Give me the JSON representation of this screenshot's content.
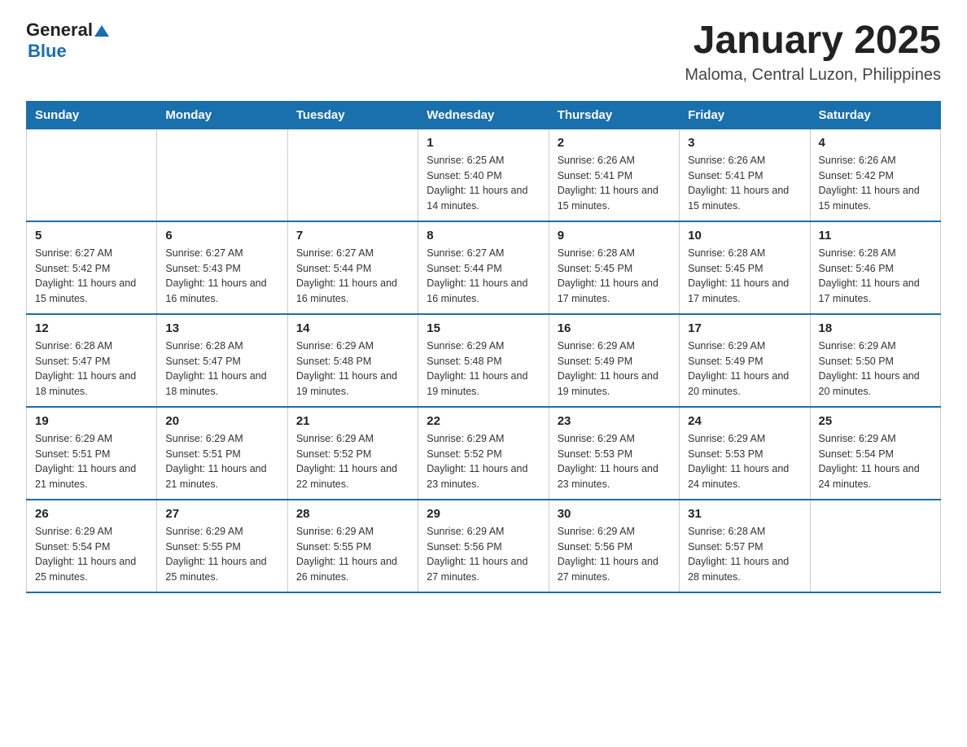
{
  "logo": {
    "general": "General",
    "blue": "Blue"
  },
  "title": "January 2025",
  "subtitle": "Maloma, Central Luzon, Philippines",
  "days_of_week": [
    "Sunday",
    "Monday",
    "Tuesday",
    "Wednesday",
    "Thursday",
    "Friday",
    "Saturday"
  ],
  "weeks": [
    [
      {
        "day": "",
        "info": ""
      },
      {
        "day": "",
        "info": ""
      },
      {
        "day": "",
        "info": ""
      },
      {
        "day": "1",
        "info": "Sunrise: 6:25 AM\nSunset: 5:40 PM\nDaylight: 11 hours and 14 minutes."
      },
      {
        "day": "2",
        "info": "Sunrise: 6:26 AM\nSunset: 5:41 PM\nDaylight: 11 hours and 15 minutes."
      },
      {
        "day": "3",
        "info": "Sunrise: 6:26 AM\nSunset: 5:41 PM\nDaylight: 11 hours and 15 minutes."
      },
      {
        "day": "4",
        "info": "Sunrise: 6:26 AM\nSunset: 5:42 PM\nDaylight: 11 hours and 15 minutes."
      }
    ],
    [
      {
        "day": "5",
        "info": "Sunrise: 6:27 AM\nSunset: 5:42 PM\nDaylight: 11 hours and 15 minutes."
      },
      {
        "day": "6",
        "info": "Sunrise: 6:27 AM\nSunset: 5:43 PM\nDaylight: 11 hours and 16 minutes."
      },
      {
        "day": "7",
        "info": "Sunrise: 6:27 AM\nSunset: 5:44 PM\nDaylight: 11 hours and 16 minutes."
      },
      {
        "day": "8",
        "info": "Sunrise: 6:27 AM\nSunset: 5:44 PM\nDaylight: 11 hours and 16 minutes."
      },
      {
        "day": "9",
        "info": "Sunrise: 6:28 AM\nSunset: 5:45 PM\nDaylight: 11 hours and 17 minutes."
      },
      {
        "day": "10",
        "info": "Sunrise: 6:28 AM\nSunset: 5:45 PM\nDaylight: 11 hours and 17 minutes."
      },
      {
        "day": "11",
        "info": "Sunrise: 6:28 AM\nSunset: 5:46 PM\nDaylight: 11 hours and 17 minutes."
      }
    ],
    [
      {
        "day": "12",
        "info": "Sunrise: 6:28 AM\nSunset: 5:47 PM\nDaylight: 11 hours and 18 minutes."
      },
      {
        "day": "13",
        "info": "Sunrise: 6:28 AM\nSunset: 5:47 PM\nDaylight: 11 hours and 18 minutes."
      },
      {
        "day": "14",
        "info": "Sunrise: 6:29 AM\nSunset: 5:48 PM\nDaylight: 11 hours and 19 minutes."
      },
      {
        "day": "15",
        "info": "Sunrise: 6:29 AM\nSunset: 5:48 PM\nDaylight: 11 hours and 19 minutes."
      },
      {
        "day": "16",
        "info": "Sunrise: 6:29 AM\nSunset: 5:49 PM\nDaylight: 11 hours and 19 minutes."
      },
      {
        "day": "17",
        "info": "Sunrise: 6:29 AM\nSunset: 5:49 PM\nDaylight: 11 hours and 20 minutes."
      },
      {
        "day": "18",
        "info": "Sunrise: 6:29 AM\nSunset: 5:50 PM\nDaylight: 11 hours and 20 minutes."
      }
    ],
    [
      {
        "day": "19",
        "info": "Sunrise: 6:29 AM\nSunset: 5:51 PM\nDaylight: 11 hours and 21 minutes."
      },
      {
        "day": "20",
        "info": "Sunrise: 6:29 AM\nSunset: 5:51 PM\nDaylight: 11 hours and 21 minutes."
      },
      {
        "day": "21",
        "info": "Sunrise: 6:29 AM\nSunset: 5:52 PM\nDaylight: 11 hours and 22 minutes."
      },
      {
        "day": "22",
        "info": "Sunrise: 6:29 AM\nSunset: 5:52 PM\nDaylight: 11 hours and 23 minutes."
      },
      {
        "day": "23",
        "info": "Sunrise: 6:29 AM\nSunset: 5:53 PM\nDaylight: 11 hours and 23 minutes."
      },
      {
        "day": "24",
        "info": "Sunrise: 6:29 AM\nSunset: 5:53 PM\nDaylight: 11 hours and 24 minutes."
      },
      {
        "day": "25",
        "info": "Sunrise: 6:29 AM\nSunset: 5:54 PM\nDaylight: 11 hours and 24 minutes."
      }
    ],
    [
      {
        "day": "26",
        "info": "Sunrise: 6:29 AM\nSunset: 5:54 PM\nDaylight: 11 hours and 25 minutes."
      },
      {
        "day": "27",
        "info": "Sunrise: 6:29 AM\nSunset: 5:55 PM\nDaylight: 11 hours and 25 minutes."
      },
      {
        "day": "28",
        "info": "Sunrise: 6:29 AM\nSunset: 5:55 PM\nDaylight: 11 hours and 26 minutes."
      },
      {
        "day": "29",
        "info": "Sunrise: 6:29 AM\nSunset: 5:56 PM\nDaylight: 11 hours and 27 minutes."
      },
      {
        "day": "30",
        "info": "Sunrise: 6:29 AM\nSunset: 5:56 PM\nDaylight: 11 hours and 27 minutes."
      },
      {
        "day": "31",
        "info": "Sunrise: 6:28 AM\nSunset: 5:57 PM\nDaylight: 11 hours and 28 minutes."
      },
      {
        "day": "",
        "info": ""
      }
    ]
  ]
}
